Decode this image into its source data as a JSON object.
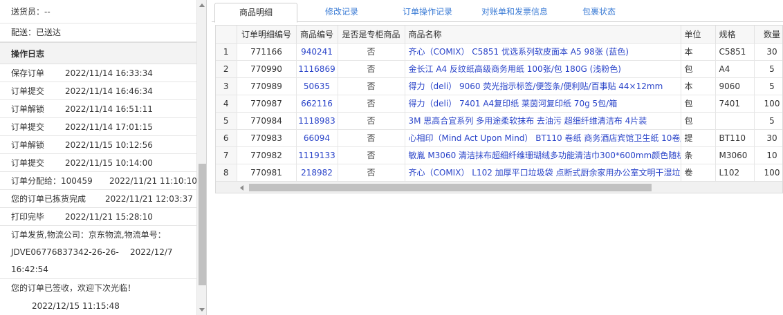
{
  "left": {
    "courier": "送货员：--",
    "delivery": "配送：已送达",
    "section_title": "操作日志",
    "logs": [
      {
        "action": "保存订单",
        "time": "2022/11/14 16:33:34"
      },
      {
        "action": "订单提交",
        "time": "2022/11/14 16:46:34"
      },
      {
        "action": "订单解锁",
        "time": "2022/11/14 16:51:11"
      },
      {
        "action": "订单提交",
        "time": "2022/11/14 17:01:15"
      },
      {
        "action": "订单解锁",
        "time": "2022/11/15 10:12:56"
      },
      {
        "action": "订单提交",
        "time": "2022/11/15 10:14:00"
      }
    ],
    "log_assign": {
      "action": "订单分配给：100459",
      "time": "2022/11/21 11:10:10"
    },
    "log_picked": {
      "action": "您的订单已拣货完成",
      "time": "2022/11/21 12:03:37"
    },
    "log_printed": {
      "action": "打印完毕",
      "time": "2022/11/21 15:28:10"
    },
    "log_shipped_line1": "订单发货,物流公司：京东物流,物流单号：",
    "log_shipped_line2_id": "JDVE06776837342-26-26-",
    "log_shipped_line2_date": "2022/12/7",
    "log_shipped_line3": "16:42:54",
    "log_signed": "您的订单已签收，欢迎下次光临！",
    "log_signed_time": "2022/12/15 11:15:48"
  },
  "tabs": [
    "商品明细",
    "修改记录",
    "订单操作记录",
    "对账单和发票信息",
    "包裹状态"
  ],
  "table": {
    "headers": [
      "",
      "订单明细编号",
      "商品编号",
      "是否是专柜商品",
      "商品名称",
      "单位",
      "规格",
      "数量"
    ],
    "rows": [
      {
        "n": "1",
        "id": "771166",
        "sku": "940241",
        "counter": "否",
        "name": "齐心（COMIX） C5851 优选系列软皮面本 A5 98张 (蓝色)",
        "unit": "本",
        "spec": "C5851",
        "qty": "30"
      },
      {
        "n": "2",
        "id": "770990",
        "sku": "1116869",
        "counter": "否",
        "name": "金长江 A4 反纹纸高级商务用纸 100张/包 180G (浅粉色)",
        "unit": "包",
        "spec": "A4",
        "qty": "5"
      },
      {
        "n": "3",
        "id": "770989",
        "sku": "50635",
        "counter": "否",
        "name": "得力（deli） 9060 荧光指示标签/便签条/便利贴/百事贴 44×12mm",
        "unit": "本",
        "spec": "9060",
        "qty": "5"
      },
      {
        "n": "4",
        "id": "770987",
        "sku": "662116",
        "counter": "否",
        "name": "得力（deli） 7401 A4复印纸 莱茵河复印纸 70g 5包/箱",
        "unit": "包",
        "spec": "7401",
        "qty": "100"
      },
      {
        "n": "5",
        "id": "770984",
        "sku": "1118983",
        "counter": "否",
        "name": "3M 思高合宜系列 多用途柔软抹布 去油污 超细纤维清洁布 4片装",
        "unit": "包",
        "spec": "",
        "qty": "5"
      },
      {
        "n": "6",
        "id": "770983",
        "sku": "66094",
        "counter": "否",
        "name": "心相印（Mind Act Upon Mind） BT110 卷纸 商务酒店宾馆卫生纸 10卷/提（",
        "unit": "提",
        "spec": "BT110",
        "qty": "30"
      },
      {
        "n": "7",
        "id": "770982",
        "sku": "1119133",
        "counter": "否",
        "name": "敏胤 M3060 清洁抹布超细纤维珊瑚绒多功能清洁巾300*600mm颜色随机",
        "unit": "条",
        "spec": "M3060",
        "qty": "10"
      },
      {
        "n": "8",
        "id": "770981",
        "sku": "218982",
        "counter": "否",
        "name": "齐心（COMIX） L102 加厚平口垃圾袋 点断式厨余家用办公室文明干湿垃圾",
        "unit": "卷",
        "spec": "L102",
        "qty": "100"
      }
    ]
  }
}
